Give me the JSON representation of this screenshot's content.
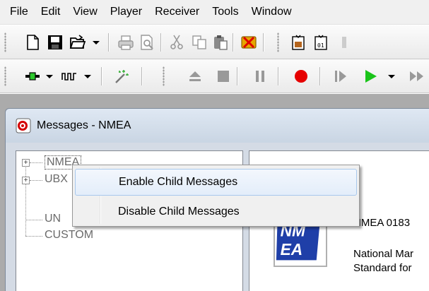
{
  "menu": [
    "File",
    "Edit",
    "View",
    "Player",
    "Receiver",
    "Tools",
    "Window"
  ],
  "toolbar1_icons": [
    "new-file-icon",
    "save-icon",
    "open-folder-icon",
    "print-icon",
    "print-preview-icon",
    "cut-icon",
    "copy-icon",
    "paste-icon",
    "stop-logging-icon",
    "export-icon",
    "export-binary-icon"
  ],
  "toolbar2_icons": [
    "connection-icon",
    "baudrate-icon",
    "autobaud-icon",
    "eject-icon",
    "stop-icon",
    "pause-icon",
    "record-icon",
    "step-forward-icon",
    "play-icon",
    "fast-forward-icon"
  ],
  "window": {
    "title": "Messages - NMEA"
  },
  "tree": {
    "items": [
      {
        "label": "NMEA",
        "expander": "+"
      },
      {
        "label": "UBX",
        "expander": "+"
      },
      {
        "label": "UN"
      },
      {
        "label": "CUSTOM"
      }
    ]
  },
  "detail": {
    "logo_text": "NMEA",
    "heading_fragment": "NMEA 0183",
    "line1": "National Mar",
    "line2": "Standard for"
  },
  "context_menu": {
    "items": [
      {
        "label": "Enable Child Messages",
        "highlighted": true
      },
      {
        "label": "Disable Child Messages",
        "highlighted": false
      }
    ]
  },
  "colors": {
    "record": "#e60000",
    "play": "#19c419",
    "mdi_background": "#ababab",
    "menu_highlight": "#a8c8ec"
  }
}
